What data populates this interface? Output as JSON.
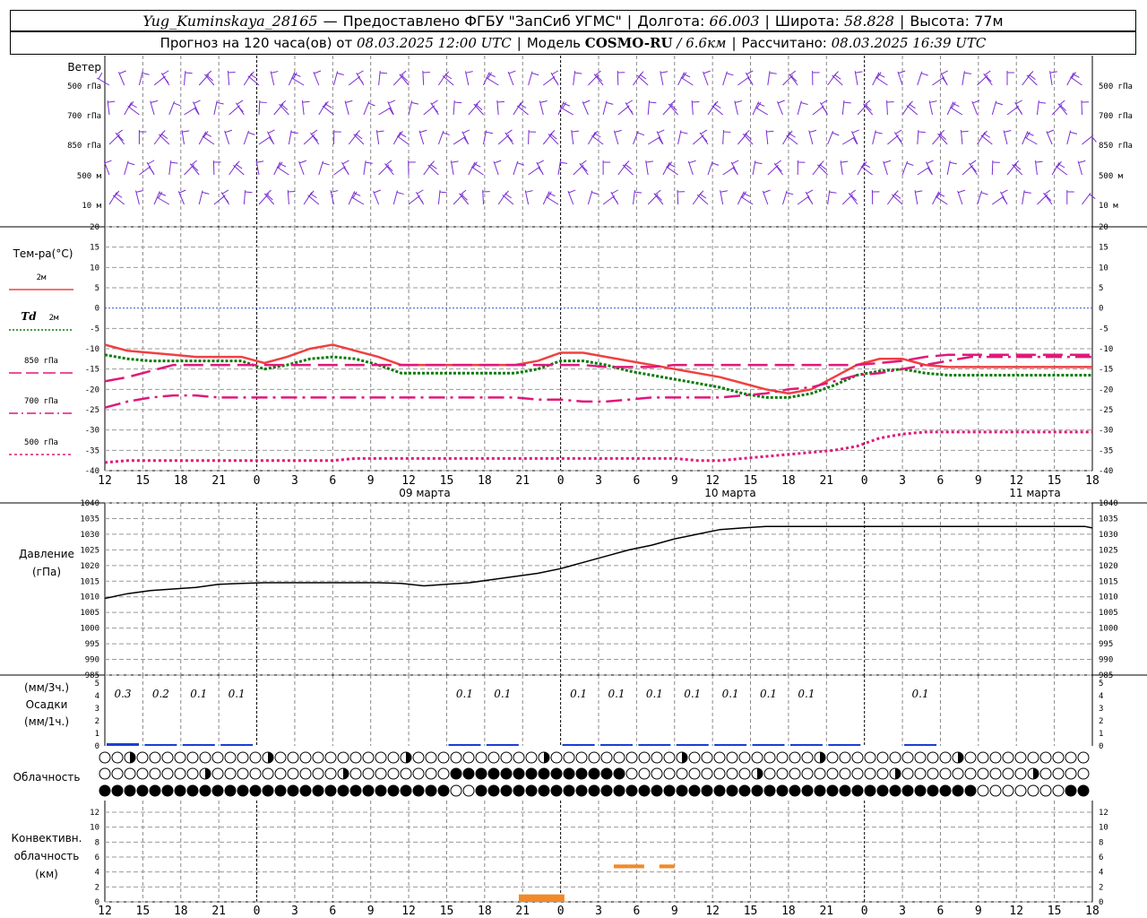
{
  "header": {
    "station": "Yug_Kuminskaya_28165",
    "dash": "—",
    "provider": "Предоставлено ФГБУ \"ЗапСиб УГМС\"",
    "lon_label": "Долгота:",
    "lon_value": "66.003",
    "lat_label": "Широта:",
    "lat_value": "58.828",
    "alt_label": "Высота:",
    "alt_value": "77м",
    "forecast_prefix": "Прогноз на 120 часа(ов) от",
    "forecast_time": "08.03.2025 12:00 UTC",
    "model_label": "Модель",
    "model_name": "COSMO-RU",
    "model_res": "/ 6.6км",
    "calc_label": "Рассчитано:",
    "calc_time": "08.03.2025 16:39 UTC"
  },
  "panels": {
    "wind": {
      "title": "Ветер",
      "levels": [
        "500 гПа",
        "700 гПа",
        "850 гПа",
        "500 м",
        "10 м"
      ],
      "color": "#7a2dd1"
    },
    "temperature": {
      "title": "Тем-ра(°C)",
      "legend": [
        {
          "label": "2м",
          "color": "#f04040",
          "style": "solid"
        },
        {
          "label": "Td 2м",
          "color": "#0a7a0a",
          "style": "dotted"
        },
        {
          "label": "850 гПа",
          "color": "#e0187a",
          "style": "longdash"
        },
        {
          "label": "700 гПа",
          "color": "#e0187a",
          "style": "dashdot"
        },
        {
          "label": "500 гПа",
          "color": "#e0187a",
          "style": "dashed"
        }
      ],
      "yticks": [
        "20",
        "15",
        "10",
        "5",
        "0",
        "-5",
        "-10",
        "-15",
        "-20",
        "-25",
        "-30",
        "-35",
        "-40"
      ],
      "xticks": [
        "12",
        "15",
        "18",
        "21",
        "0",
        "3",
        "6",
        "9",
        "12",
        "15",
        "18",
        "21",
        "0",
        "3",
        "6",
        "9",
        "12",
        "15",
        "18",
        "21",
        "0",
        "3",
        "6",
        "9",
        "12",
        "15",
        "18"
      ],
      "day_labels": [
        "09 марта",
        "10 марта",
        "11 марта"
      ]
    },
    "pressure": {
      "title": "Давление",
      "unit": "(гПа)",
      "yticks": [
        "1040",
        "1035",
        "1030",
        "1025",
        "1020",
        "1015",
        "1010",
        "1005",
        "1000",
        "995",
        "990",
        "985"
      ]
    },
    "precip": {
      "unit_top": "(мм/3ч.)",
      "title": "Осадки",
      "unit_bottom": "(мм/1ч.)",
      "yticks": [
        "5",
        "4",
        "3",
        "2",
        "1",
        "0"
      ],
      "labels": [
        "0.3",
        "0.2",
        "0.1",
        "0.1",
        "0.1",
        "0.1",
        "0.1",
        "0.1",
        "0.1",
        "0.1",
        "0.1",
        "0.1",
        "0.1",
        "0.1"
      ]
    },
    "cloud": {
      "title": "Облачность"
    },
    "convective": {
      "title_1": "Конвективн.",
      "title_2": "облачность",
      "unit": "(км)",
      "yticks": [
        "12",
        "10",
        "8",
        "6",
        "4",
        "2",
        "0"
      ],
      "xticks": [
        "12",
        "15",
        "18",
        "21",
        "0",
        "3",
        "6",
        "9",
        "12",
        "15",
        "18",
        "21",
        "0",
        "3",
        "6",
        "9",
        "12",
        "15",
        "18",
        "21",
        "0",
        "3",
        "6",
        "9",
        "12",
        "15",
        "18"
      ]
    }
  },
  "chart_data": [
    {
      "type": "line",
      "title": "Тем-ра(°C)",
      "ylim": [
        -40,
        20
      ],
      "x_hours": [
        0,
        3,
        6,
        9,
        12,
        15,
        18,
        21,
        24,
        27,
        30,
        33,
        36,
        39,
        42,
        45,
        48,
        51,
        54,
        57,
        60,
        63,
        66,
        69,
        72,
        75,
        78,
        81,
        84,
        87,
        90,
        93,
        96,
        99,
        102,
        105,
        108,
        111,
        114,
        117,
        120,
        123,
        126,
        129,
        130
      ],
      "series": [
        {
          "name": "2м",
          "color": "#f04040",
          "values": [
            -9,
            -10.5,
            -11,
            -11.5,
            -12,
            -12,
            -12,
            -13.5,
            -12,
            -10,
            -9,
            -10.5,
            -12,
            -14,
            -14,
            -14,
            -14,
            -14,
            -14,
            -13,
            -11,
            -11,
            -12,
            -13,
            -14,
            -15,
            -16,
            -17,
            -18.5,
            -20,
            -21,
            -20,
            -17,
            -14,
            -12.5,
            -12.5,
            -14,
            -14.5,
            -14.5,
            -14.5,
            -14.5,
            -14.5,
            -14.5,
            -14.5,
            -14.5
          ]
        },
        {
          "name": "Td 2м",
          "color": "#0a7a0a",
          "values": [
            -11.5,
            -12.5,
            -13,
            -13,
            -13,
            -13,
            -13,
            -15,
            -14,
            -12.5,
            -12,
            -12.5,
            -14,
            -16,
            -16,
            -16,
            -16,
            -16,
            -16,
            -15,
            -13,
            -13,
            -14,
            -15.5,
            -16.5,
            -17.5,
            -18.5,
            -19.5,
            -21,
            -22,
            -22,
            -21,
            -19,
            -16.5,
            -15.5,
            -15,
            -16,
            -16.5,
            -16.5,
            -16.5,
            -16.5,
            -16.5,
            -16.5,
            -16.5,
            -16.5
          ]
        },
        {
          "name": "850 гПа",
          "color": "#e0187a",
          "values": [
            -18,
            -17,
            -15.5,
            -14,
            -14,
            -14,
            -14,
            -14,
            -14,
            -14,
            -14,
            -14,
            -14,
            -14,
            -14,
            -14,
            -14,
            -14,
            -14,
            -14,
            -14,
            -14,
            -14.5,
            -14.5,
            -14.5,
            -14,
            -14,
            -14,
            -14,
            -14,
            -14,
            -14,
            -14,
            -14,
            -13.5,
            -13,
            -12,
            -11.5,
            -11.5,
            -11.5,
            -11.5,
            -11.5,
            -11.5,
            -11.5,
            -11.5
          ]
        },
        {
          "name": "700 гПа",
          "color": "#e0187a",
          "values": [
            -24.5,
            -23,
            -22,
            -21.5,
            -21.5,
            -22,
            -22,
            -22,
            -22,
            -22,
            -22,
            -22,
            -22,
            -22,
            -22,
            -22,
            -22,
            -22,
            -22,
            -22.5,
            -22.5,
            -23,
            -23,
            -22.5,
            -22,
            -22,
            -22,
            -22,
            -21.5,
            -21,
            -20,
            -19.5,
            -18,
            -16.5,
            -16,
            -15,
            -14,
            -13,
            -12,
            -12,
            -12,
            -12,
            -12,
            -12,
            -12
          ]
        },
        {
          "name": "500 гПа",
          "color": "#e0187a",
          "values": [
            -38,
            -37.5,
            -37.5,
            -37.5,
            -37.5,
            -37.5,
            -37.5,
            -37.5,
            -37.5,
            -37.5,
            -37.5,
            -37,
            -37,
            -37,
            -37,
            -37,
            -37,
            -37,
            -37,
            -37,
            -37,
            -37,
            -37,
            -37,
            -37,
            -37,
            -37.5,
            -37.5,
            -37,
            -36.5,
            -36,
            -35.5,
            -35,
            -34,
            -32,
            -31,
            -30.5,
            -30.5,
            -30.5,
            -30.5,
            -30.5,
            -30.5,
            -30.5,
            -30.5,
            -30.5
          ]
        }
      ]
    },
    {
      "type": "line",
      "title": "Давление (гПа)",
      "ylim": [
        985,
        1040
      ],
      "x_hours": [
        0,
        3,
        6,
        9,
        12,
        15,
        18,
        21,
        24,
        27,
        30,
        33,
        36,
        39,
        42,
        45,
        48,
        51,
        54,
        57,
        60,
        63,
        66,
        69,
        72,
        75,
        78,
        81,
        84,
        87,
        90,
        93,
        96,
        99,
        102,
        105,
        108,
        111,
        114,
        117,
        120,
        123,
        126,
        129,
        130
      ],
      "series": [
        {
          "name": "Давление",
          "color": "#000000",
          "values": [
            1009.5,
            1011,
            1012,
            1012.5,
            1013,
            1014,
            1014.3,
            1014.5,
            1014.5,
            1014.5,
            1014.5,
            1014.5,
            1014.5,
            1014.3,
            1013.5,
            1014,
            1014.5,
            1015.5,
            1016.5,
            1017.5,
            1019,
            1021,
            1023,
            1025,
            1026.5,
            1028.5,
            1030,
            1031.5,
            1032,
            1032.5,
            1032.5,
            1032.5,
            1032.5,
            1032.5,
            1032.5,
            1032.5,
            1032.5,
            1032.5,
            1032.5,
            1032.5,
            1032.5,
            1032.5,
            1032.5,
            1032.5,
            1032
          ]
        }
      ]
    },
    {
      "type": "bar",
      "title": "Осадки",
      "ylim": [
        0,
        5
      ],
      "categories": [
        "12",
        "15",
        "18",
        "21",
        "0",
        "3",
        "6",
        "9",
        "12",
        "15",
        "18",
        "21",
        "0",
        "3",
        "6",
        "9",
        "12",
        "15",
        "18",
        "21",
        "0",
        "3",
        "6",
        "9",
        "12",
        "15",
        "18"
      ],
      "values": [
        0.3,
        0.2,
        0.1,
        0.1,
        0,
        0,
        0,
        0,
        0,
        0.1,
        0.1,
        0,
        0.1,
        0.1,
        0.1,
        0.1,
        0.1,
        0.1,
        0.1,
        0.1,
        0,
        0.1,
        0,
        0,
        0,
        0,
        0
      ]
    },
    {
      "type": "bar",
      "title": "Конвективн. облачность (км)",
      "ylim": [
        0,
        12
      ],
      "segments": [
        {
          "x0": 54.5,
          "x1": 60.5,
          "base": 0,
          "top": 1,
          "color": "#f08a2a"
        },
        {
          "x0": 67,
          "x1": 69,
          "base": 4.5,
          "top": 5,
          "color": "#f08a2a"
        },
        {
          "x0": 69,
          "x1": 71,
          "base": 4.5,
          "top": 5,
          "color": "#f08a2a"
        },
        {
          "x0": 73,
          "x1": 75,
          "base": 4.5,
          "top": 5,
          "color": "#f08a2a"
        }
      ]
    }
  ]
}
